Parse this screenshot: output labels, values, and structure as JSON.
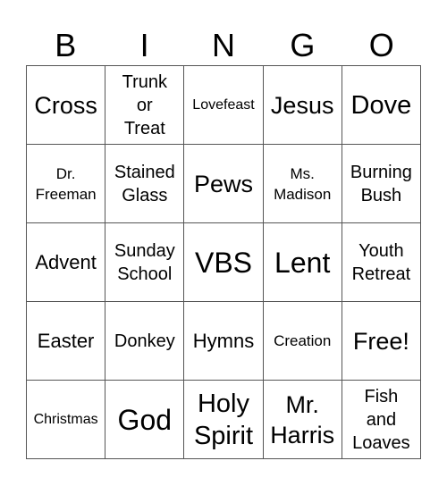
{
  "header": [
    "B",
    "I",
    "N",
    "G",
    "O"
  ],
  "cells": [
    [
      "Cross",
      "Trunk\nor\nTreat",
      "Lovefeast",
      "Jesus",
      "Dove"
    ],
    [
      "Dr.\nFreeman",
      "Stained\nGlass",
      "Pews",
      "Ms.\nMadison",
      "Burning\nBush"
    ],
    [
      "Advent",
      "Sunday\nSchool",
      "VBS",
      "Lent",
      "Youth\nRetreat"
    ],
    [
      "Easter",
      "Donkey",
      "Hymns",
      "Creation",
      "Free!"
    ],
    [
      "Christmas",
      "God",
      "Holy\nSpirit",
      "Mr.\nHarris",
      "Fish\nand\nLoaves"
    ]
  ]
}
